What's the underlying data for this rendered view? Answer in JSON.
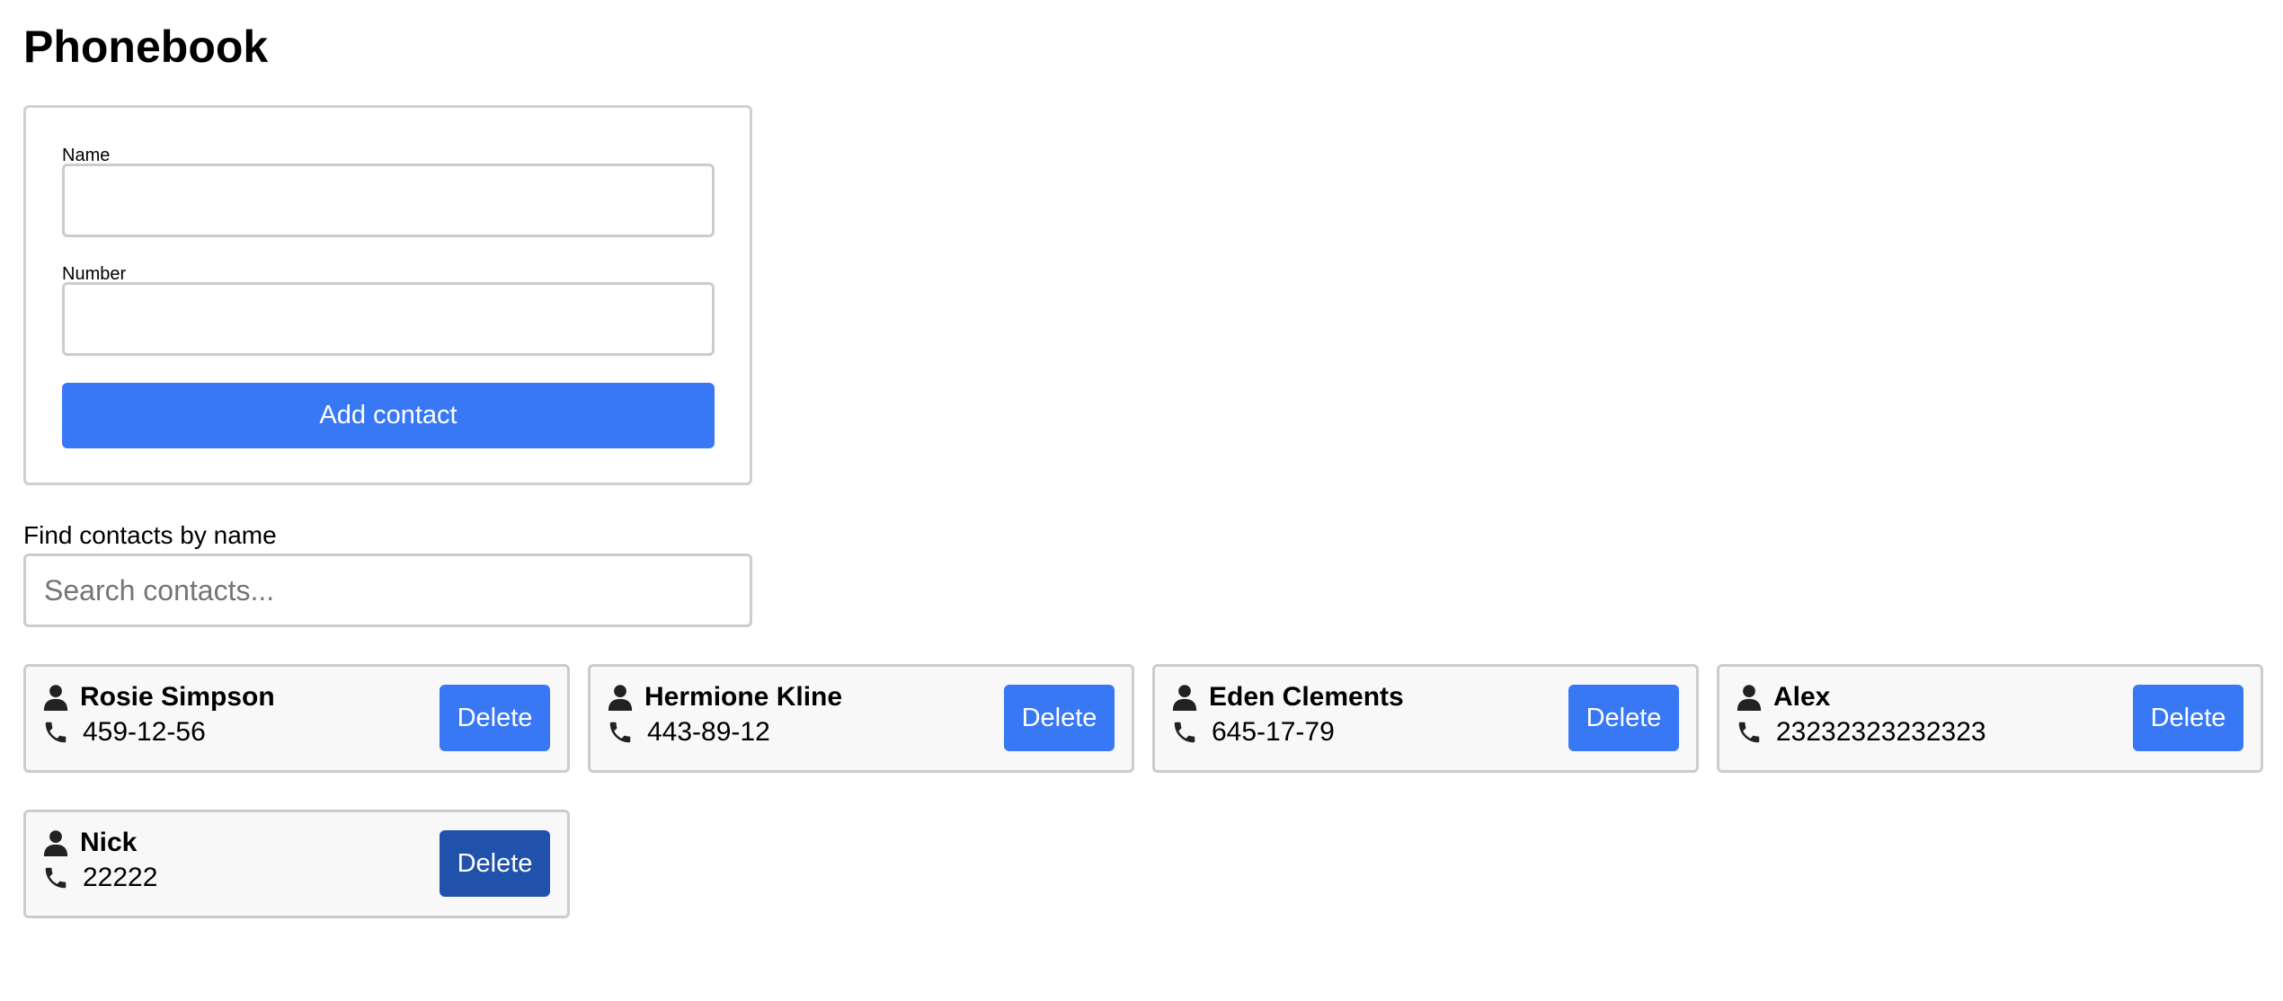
{
  "header": {
    "title": "Phonebook"
  },
  "form": {
    "name_label": "Name",
    "name_value": "",
    "number_label": "Number",
    "number_value": "",
    "submit_label": "Add contact"
  },
  "filter": {
    "label": "Find contacts by name",
    "placeholder": "Search contacts...",
    "value": ""
  },
  "contacts": [
    {
      "name": "Rosie Simpson",
      "number": "459-12-56",
      "delete_label": "Delete"
    },
    {
      "name": "Hermione Kline",
      "number": "443-89-12",
      "delete_label": "Delete"
    },
    {
      "name": "Eden Clements",
      "number": "645-17-79",
      "delete_label": "Delete"
    },
    {
      "name": "Alex",
      "number": "23232323232323",
      "delete_label": "Delete"
    },
    {
      "name": "Nick",
      "number": "22222",
      "delete_label": "Delete",
      "state": "hovered"
    }
  ],
  "icons": {
    "contact": "user-icon",
    "phone": "phone-icon"
  },
  "colors": {
    "accent": "#3878f5",
    "accent_hover": "#2152ab",
    "card_bg": "#f8f8f8",
    "border": "#cccccc"
  }
}
